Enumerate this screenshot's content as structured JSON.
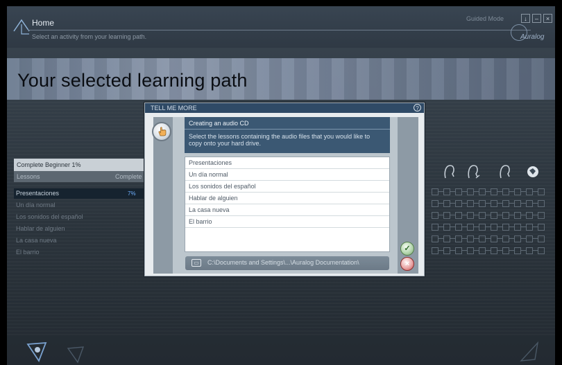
{
  "header": {
    "title": "Home",
    "subtitle": "Select an activity from your learning path.",
    "guided_mode": "Guided Mode",
    "logo": "Auralog",
    "buttons": {
      "download": "↓",
      "minimize": "–",
      "close": "×"
    }
  },
  "banner": {
    "title": "Your selected learning path"
  },
  "path_panel": {
    "course": "Complete Beginner 1%",
    "col_lessons": "Lessons",
    "col_complete": "Complete",
    "lessons": [
      {
        "name": "Presentaciones",
        "percent": "7%",
        "selected": true
      },
      {
        "name": "Un día normal",
        "selected": false
      },
      {
        "name": "Los sonidos del español",
        "selected": false
      },
      {
        "name": "Hablar de alguien",
        "selected": false
      },
      {
        "name": "La casa nueva",
        "selected": false
      },
      {
        "name": "El barrio",
        "selected": false
      }
    ]
  },
  "dialog": {
    "title": "TELL ME MORE",
    "help": "?",
    "info_title": "Creating an audio CD",
    "info_desc": "Select the lessons containing the audio files that you would like to copy onto your hard drive.",
    "list_items": [
      "Presentaciones",
      "Un día normal",
      "Los sonidos del español",
      "Hablar de alguien",
      "La casa nueva",
      "El barrio"
    ],
    "path": "C:\\Documents and Settings\\...\\Auralog Documentation\\",
    "ok": "✓",
    "cancel": "×"
  },
  "colors": {
    "titlebar": "#2f4a66",
    "info_bg": "#3b5873",
    "ok": "#7aa571",
    "cancel": "#c24a4a"
  }
}
